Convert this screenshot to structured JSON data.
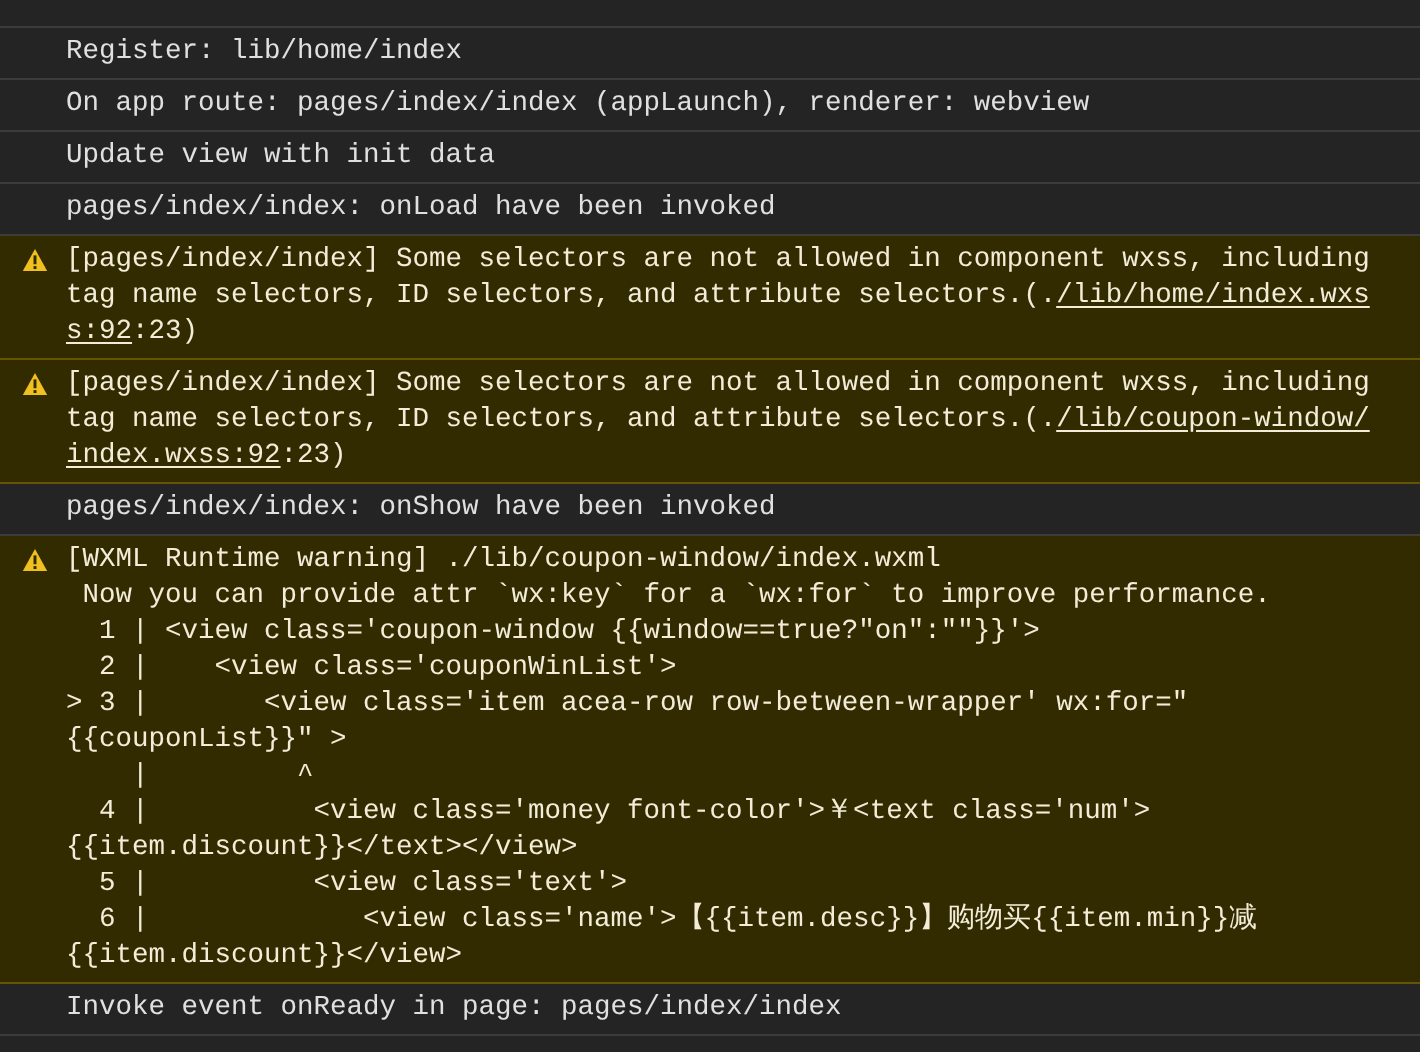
{
  "console": {
    "entries": [
      {
        "kind": "log",
        "lines": [
          [
            {
              "text": "Register: lib/home/index"
            }
          ]
        ]
      },
      {
        "kind": "log",
        "lines": [
          [
            {
              "text": "On app route: pages/index/index (appLaunch), renderer: webview"
            }
          ]
        ]
      },
      {
        "kind": "log",
        "lines": [
          [
            {
              "text": "Update view with init data"
            }
          ]
        ]
      },
      {
        "kind": "log",
        "lines": [
          [
            {
              "text": "pages/index/index: onLoad have been invoked"
            }
          ]
        ]
      },
      {
        "kind": "warning",
        "lines": [
          [
            {
              "text": "[pages/index/index] Some selectors are not allowed in component wxss, including"
            }
          ],
          [
            {
              "text": "tag name selectors, ID selectors, and attribute selectors.(."
            },
            {
              "text": "/lib/home/index.wxs",
              "link": true
            }
          ],
          [
            {
              "text": "s:92",
              "link": true
            },
            {
              "text": ":23)"
            }
          ]
        ]
      },
      {
        "kind": "warning",
        "lines": [
          [
            {
              "text": "[pages/index/index] Some selectors are not allowed in component wxss, including"
            }
          ],
          [
            {
              "text": "tag name selectors, ID selectors, and attribute selectors.(."
            },
            {
              "text": "/lib/coupon-window/",
              "link": true
            }
          ],
          [
            {
              "text": "index.wxss:92",
              "link": true
            },
            {
              "text": ":23)"
            }
          ]
        ]
      },
      {
        "kind": "log",
        "lines": [
          [
            {
              "text": "pages/index/index: onShow have been invoked"
            }
          ]
        ]
      },
      {
        "kind": "warning",
        "lines": [
          [
            {
              "text": "[WXML Runtime warning] ./lib/coupon-window/index.wxml"
            }
          ],
          [
            {
              "text": " Now you can provide attr `wx:key` for a `wx:for` to improve performance."
            }
          ],
          [
            {
              "text": "  1 | <view class='coupon-window {{window==true?\"on\":\"\"}}'>"
            }
          ],
          [
            {
              "text": "  2 |    <view class='couponWinList'>"
            }
          ],
          [
            {
              "text": "> 3 |       <view class='item acea-row row-between-wrapper' wx:for=\""
            }
          ],
          [
            {
              "text": "{{couponList}}\" >"
            }
          ],
          [
            {
              "text": "    |         ^"
            }
          ],
          [
            {
              "text": "  4 |          <view class='money font-color'>￥<text class='num'>"
            }
          ],
          [
            {
              "text": "{{item.discount}}</text></view>"
            }
          ],
          [
            {
              "text": "  5 |          <view class='text'>"
            }
          ],
          [
            {
              "text": "  6 |             <view class='name'>【{{item.desc}}】购物买{{item.min}}减"
            }
          ],
          [
            {
              "text": "{{item.discount}}</view>"
            }
          ]
        ]
      },
      {
        "kind": "log",
        "lines": [
          [
            {
              "text": "Invoke event onReady in page: pages/index/index"
            }
          ]
        ]
      }
    ]
  }
}
